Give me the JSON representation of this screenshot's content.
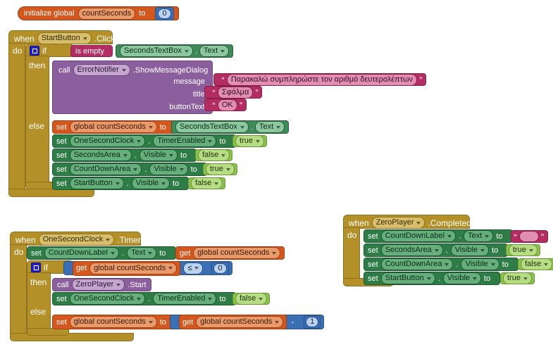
{
  "workspace": {
    "background": "#ffffff",
    "app": "MIT App Inventor Blocks Editor"
  },
  "colors": {
    "event": "#B49029",
    "variable": "#D4581E",
    "setter": "#2E7D46",
    "getter": "#3E8A58",
    "text": "#B32D62",
    "procedure_call": "#8B5F9E",
    "logic": "#8BC34A",
    "math": "#3B6FB5",
    "mutator": "#1f1fd0"
  },
  "global_init": {
    "keyword": "initialize global",
    "name": "countSeconds",
    "to": "to",
    "value": "0"
  },
  "start_button_click": {
    "when": "when",
    "component": "StartButton",
    "event": ".Click",
    "do": "do",
    "if": "if",
    "then": "then",
    "else": "else",
    "condition": {
      "operator": "is empty",
      "component": "SecondsTextBox",
      "dot": ".",
      "property": "Text"
    },
    "then_call": {
      "call": "call",
      "component": "ErrorNotifier",
      "method": ".ShowMessageDialog",
      "params": [
        {
          "label": "message",
          "value": "Παρακαλώ συμπληρώστε τον αριθμό δευτερολέπτων"
        },
        {
          "label": "title",
          "value": "Σφάλμα"
        },
        {
          "label": "buttonText",
          "value": "OK"
        }
      ]
    },
    "else_statements": [
      {
        "set": "set",
        "target": "global countSeconds",
        "dot": "",
        "property": "",
        "to": "to",
        "value_kind": "component_getter",
        "value_component": "SecondsTextBox",
        "value_property": "Text"
      },
      {
        "set": "set",
        "target": "OneSecondClock",
        "dot": ".",
        "property": "TimerEnabled",
        "to": "to",
        "value_kind": "logic",
        "value": "true"
      },
      {
        "set": "set",
        "target": "SecondsArea",
        "dot": ".",
        "property": "Visible",
        "to": "to",
        "value_kind": "logic",
        "value": "false"
      },
      {
        "set": "set",
        "target": "CountDownArea",
        "dot": ".",
        "property": "Visible",
        "to": "to",
        "value_kind": "logic",
        "value": "true"
      },
      {
        "set": "set",
        "target": "StartButton",
        "dot": ".",
        "property": "Visible",
        "to": "to",
        "value_kind": "logic",
        "value": "false"
      }
    ]
  },
  "one_second_clock_timer": {
    "when": "when",
    "component": "OneSecondClock",
    "event": ".Timer",
    "do": "do",
    "if": "if",
    "then": "then",
    "else": "else",
    "first_set": {
      "set": "set",
      "target": "CountDownLabel",
      "dot": ".",
      "property": "Text",
      "to": "to",
      "get": "get",
      "variable": "global countSeconds"
    },
    "condition": {
      "get": "get",
      "variable": "global countSeconds",
      "operator": "≤",
      "right": "0"
    },
    "then_statements": [
      {
        "kind": "call",
        "call": "call",
        "component": "ZeroPlayer",
        "method": ".Start"
      },
      {
        "kind": "set",
        "set": "set",
        "target": "OneSecondClock",
        "dot": ".",
        "property": "TimerEnabled",
        "to": "to",
        "value": "false"
      }
    ],
    "else_statement": {
      "set": "set",
      "target": "global countSeconds",
      "to": "to",
      "get": "get",
      "variable": "global countSeconds",
      "operator": "-",
      "right": "1"
    }
  },
  "zero_player_completed": {
    "when": "when",
    "component": "ZeroPlayer",
    "event": ".Completed",
    "do": "do",
    "statements": [
      {
        "set": "set",
        "target": "CountDownLabel",
        "dot": ".",
        "property": "Text",
        "to": "to",
        "value_kind": "text",
        "value": ""
      },
      {
        "set": "set",
        "target": "SecondsArea",
        "dot": ".",
        "property": "Visible",
        "to": "to",
        "value_kind": "logic",
        "value": "true"
      },
      {
        "set": "set",
        "target": "CountDownArea",
        "dot": ".",
        "property": "Visible",
        "to": "to",
        "value_kind": "logic",
        "value": "false"
      },
      {
        "set": "set",
        "target": "StartButton",
        "dot": ".",
        "property": "Visible",
        "to": "to",
        "value_kind": "logic",
        "value": "true"
      }
    ]
  }
}
